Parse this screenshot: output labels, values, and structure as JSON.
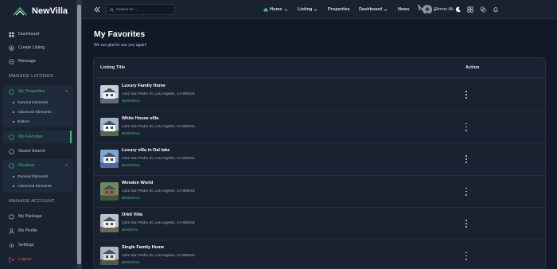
{
  "brand": {
    "name": "NewVilla"
  },
  "sidebar": {
    "items": [
      {
        "label": "Dashboard",
        "icon": "dashboard-icon"
      },
      {
        "label": "Create Listing",
        "icon": "plus-circle-icon"
      },
      {
        "label": "Message",
        "icon": "message-icon"
      }
    ],
    "section_listings": "MANAGE LISTINGS",
    "my_properties": {
      "label": "My Properties",
      "subs": [
        "General Elements",
        "Advanced Elements",
        "Editors"
      ]
    },
    "my_favorites": "My Favorites",
    "saved_search": "Saved Search",
    "reviews": {
      "label": "Reviews",
      "subs": [
        "General Elements",
        "Advanced Elements"
      ]
    },
    "section_account": "MANAGE ACCOUNT",
    "account_items": [
      {
        "label": "My Package",
        "icon": "package-icon"
      },
      {
        "label": "My Profile",
        "icon": "user-icon"
      },
      {
        "label": "Settings",
        "icon": "gear-icon"
      },
      {
        "label": "Logout",
        "icon": "logout-icon"
      }
    ]
  },
  "topbar": {
    "search_placeholder": "Search for ...",
    "menu": [
      "Home",
      "Listing",
      "Properties",
      "Dashboard",
      "News",
      "Pages"
    ],
    "user_name": "Rimon Ali"
  },
  "main": {
    "title": "My Favorites",
    "subtitle": "We are glad to see you again!",
    "table": {
      "col_title": "Listing Title",
      "col_action": "Action",
      "rows": [
        {
          "title": "Luxury Family Home",
          "address": "1421 San Pedro St, Los Angeles, CA 900015",
          "price": "$19000/mo"
        },
        {
          "title": "White House villa",
          "address": "1421 San Pedro St, Los Angeles, CA 900015",
          "price": "$18000/mo"
        },
        {
          "title": "Luxury villa in Dal lake",
          "address": "1421 San Pedro St, Los Angeles, CA 900015",
          "price": "$63000/mo"
        },
        {
          "title": "Wooden World",
          "address": "1421 San Pedro St, Los Angeles, CA 900015",
          "price": "$63000/mo"
        },
        {
          "title": "Orkit Villa",
          "address": "1421 San Pedro St, Los Angeles, CA 900015",
          "price": "$1000/mo"
        },
        {
          "title": "Single Family Home",
          "address": "1421 San Pedro St, Los Angeles, CA 900015",
          "price": "$20000/mo"
        }
      ]
    }
  },
  "colors": {
    "accent": "#3dbb73",
    "background": "#111928",
    "panel": "#1a2232",
    "danger": "#e0524b"
  }
}
